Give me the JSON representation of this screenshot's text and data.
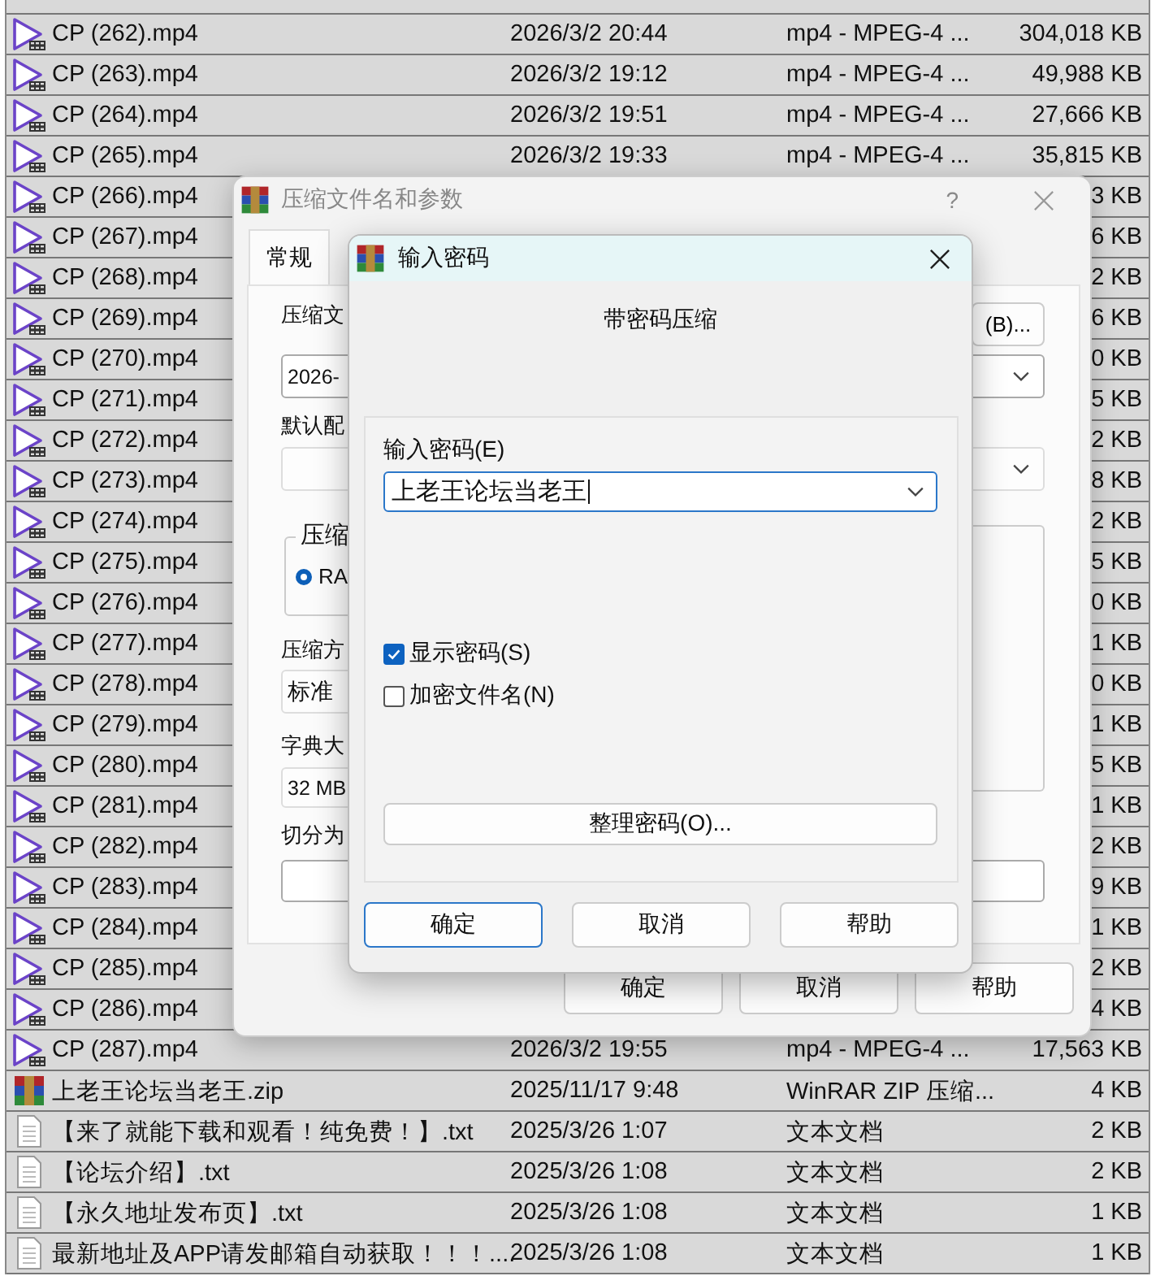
{
  "file_list": {
    "rows": [
      {
        "kind": "video",
        "name": "CP (262).mp4",
        "date": "2026/3/2 20:44",
        "type": "mp4 - MPEG-4 ...",
        "size": "304,018 KB"
      },
      {
        "kind": "video",
        "name": "CP (263).mp4",
        "date": "2026/3/2 19:12",
        "type": "mp4 - MPEG-4 ...",
        "size": "49,988 KB"
      },
      {
        "kind": "video",
        "name": "CP (264).mp4",
        "date": "2026/3/2 19:51",
        "type": "mp4 - MPEG-4 ...",
        "size": "27,666 KB"
      },
      {
        "kind": "video",
        "name": "CP (265).mp4",
        "date": "2026/3/2 19:33",
        "type": "mp4 - MPEG-4 ...",
        "size": "35,815 KB"
      },
      {
        "kind": "video",
        "name": "CP (266).mp4",
        "size": "3 KB"
      },
      {
        "kind": "video",
        "name": "CP (267).mp4",
        "size": "6 KB"
      },
      {
        "kind": "video",
        "name": "CP (268).mp4",
        "size": "2 KB"
      },
      {
        "kind": "video",
        "name": "CP (269).mp4",
        "size": "6 KB"
      },
      {
        "kind": "video",
        "name": "CP (270).mp4",
        "size": "0 KB"
      },
      {
        "kind": "video",
        "name": "CP (271).mp4",
        "size": "5 KB"
      },
      {
        "kind": "video",
        "name": "CP (272).mp4",
        "size": "2 KB"
      },
      {
        "kind": "video",
        "name": "CP (273).mp4",
        "size": "8 KB"
      },
      {
        "kind": "video",
        "name": "CP (274).mp4",
        "size": "2 KB"
      },
      {
        "kind": "video",
        "name": "CP (275).mp4",
        "size": "5 KB"
      },
      {
        "kind": "video",
        "name": "CP (276).mp4",
        "size": "0 KB"
      },
      {
        "kind": "video",
        "name": "CP (277).mp4",
        "size": "1 KB"
      },
      {
        "kind": "video",
        "name": "CP (278).mp4",
        "size": "0 KB"
      },
      {
        "kind": "video",
        "name": "CP (279).mp4",
        "size": "1 KB"
      },
      {
        "kind": "video",
        "name": "CP (280).mp4",
        "size": "5 KB"
      },
      {
        "kind": "video",
        "name": "CP (281).mp4",
        "size": "1 KB"
      },
      {
        "kind": "video",
        "name": "CP (282).mp4",
        "size": "2 KB"
      },
      {
        "kind": "video",
        "name": "CP (283).mp4",
        "size": "9 KB"
      },
      {
        "kind": "video",
        "name": "CP (284).mp4",
        "size": "1 KB"
      },
      {
        "kind": "video",
        "name": "CP (285).mp4",
        "size": "2 KB"
      },
      {
        "kind": "video",
        "name": "CP (286).mp4",
        "size": "4 KB"
      },
      {
        "kind": "video",
        "name": "CP (287).mp4",
        "date": "2026/3/2 19:55",
        "type": "mp4 - MPEG-4 ...",
        "size": "17,563 KB"
      },
      {
        "kind": "archive",
        "name": "上老王论坛当老王.zip",
        "date": "2025/11/17 9:48",
        "type": "WinRAR ZIP 压缩...",
        "size": "4 KB"
      },
      {
        "kind": "text",
        "name": "【来了就能下载和观看！纯免费！】.txt",
        "date": "2025/3/26 1:07",
        "type": "文本文档",
        "size": "2 KB"
      },
      {
        "kind": "text",
        "name": "【论坛介绍】.txt",
        "date": "2025/3/26 1:08",
        "type": "文本文档",
        "size": "2 KB"
      },
      {
        "kind": "text",
        "name": "【永久地址发布页】.txt",
        "date": "2025/3/26 1:08",
        "type": "文本文档",
        "size": "1 KB"
      },
      {
        "kind": "text",
        "name": "最新地址及APP请发邮箱自动获取！！！....",
        "date": "2025/3/26 1:08",
        "type": "文本文档",
        "size": "1 KB"
      }
    ]
  },
  "archive_dialog": {
    "title": "压缩文件名和参数",
    "help": "?",
    "tabs": [
      {
        "label": "常规",
        "selected": true
      }
    ],
    "archive_name_label": "压缩文",
    "archive_name_value": "2026-",
    "browse_button": "(B)...",
    "profile_label": "默认配",
    "format_group_label": "压缩",
    "format_option": {
      "label": "RA",
      "selected": true
    },
    "method_label": "压缩方",
    "method_value": "标准",
    "dictionary_label": "字典大",
    "dictionary_value": "32 MB",
    "split_label": "切分为",
    "buttons": [
      "确定",
      "取消",
      "帮助"
    ]
  },
  "password_dialog": {
    "title": "输入密码",
    "heading": "带密码压缩",
    "password_label": "输入密码(E)",
    "password_value": "上老王论坛当老王",
    "options": [
      {
        "label": "显示密码(S)",
        "checked": true
      },
      {
        "label": "加密文件名(N)",
        "checked": false
      }
    ],
    "organize_button": "整理密码(O)...",
    "buttons": [
      {
        "label": "确定",
        "default": true
      },
      {
        "label": "取消",
        "default": false
      },
      {
        "label": "帮助",
        "default": false
      }
    ]
  }
}
